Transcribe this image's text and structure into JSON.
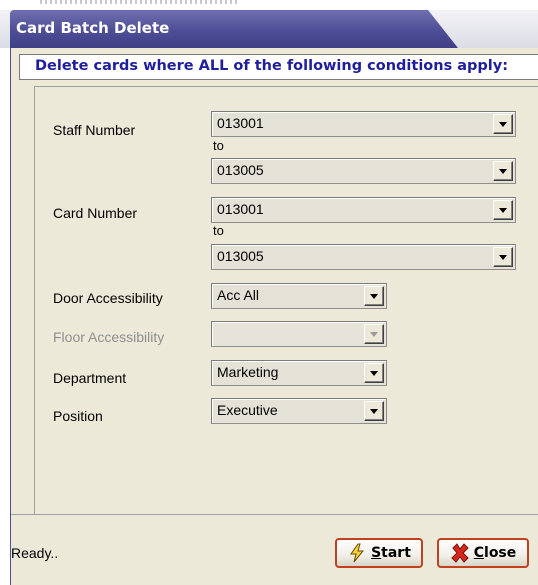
{
  "window": {
    "title": "Card Batch Delete"
  },
  "heading": "Delete cards where ALL of the following conditions apply:",
  "form": {
    "staff_number": {
      "label": "Staff Number",
      "from": "013001",
      "to_label": "to",
      "to": "013005"
    },
    "card_number": {
      "label": "Card Number",
      "from": "013001",
      "to_label": "to",
      "to": "013005"
    },
    "door_accessibility": {
      "label": "Door Accessibility",
      "value": "Acc All"
    },
    "floor_accessibility": {
      "label": "Floor Accessibility",
      "value": ""
    },
    "department": {
      "label": "Department",
      "value": "Marketing"
    },
    "position": {
      "label": "Position",
      "value": "Executive"
    }
  },
  "status": "Ready..",
  "buttons": {
    "start": {
      "mnemonic": "S",
      "rest": "tart"
    },
    "close": {
      "mnemonic": "C",
      "rest": "lose"
    }
  },
  "colors": {
    "title_bar": "#4e4e96",
    "heading_text": "#1f1f9e",
    "button_border": "#c0401f",
    "window_bg": "#ece9d8"
  }
}
